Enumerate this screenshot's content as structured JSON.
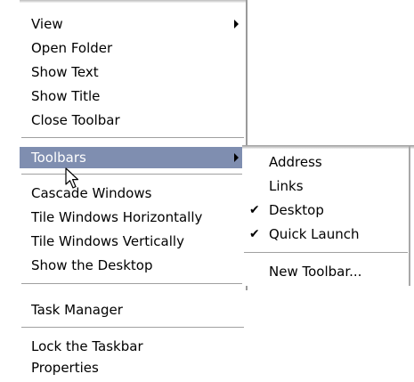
{
  "context_menu": {
    "items": [
      {
        "label": "View"
      },
      {
        "label": "Open Folder"
      },
      {
        "label": "Show Text"
      },
      {
        "label": "Show Title"
      },
      {
        "label": "Close Toolbar"
      },
      {
        "label": "Toolbars"
      },
      {
        "label": "Cascade Windows"
      },
      {
        "label": "Tile Windows Horizontally"
      },
      {
        "label": "Tile Windows Vertically"
      },
      {
        "label": "Show the Desktop"
      },
      {
        "label": "Task Manager"
      },
      {
        "label": "Lock the Taskbar"
      },
      {
        "label": "Properties"
      }
    ],
    "highlight_color": "#7f8eb0"
  },
  "toolbars_submenu": {
    "items": [
      {
        "label": "Address",
        "checked": false
      },
      {
        "label": "Links",
        "checked": false
      },
      {
        "label": "Desktop",
        "checked": true
      },
      {
        "label": "Quick Launch",
        "checked": true
      },
      {
        "label": "New Toolbar...",
        "checked": false
      }
    ],
    "check_glyph": "✔"
  }
}
